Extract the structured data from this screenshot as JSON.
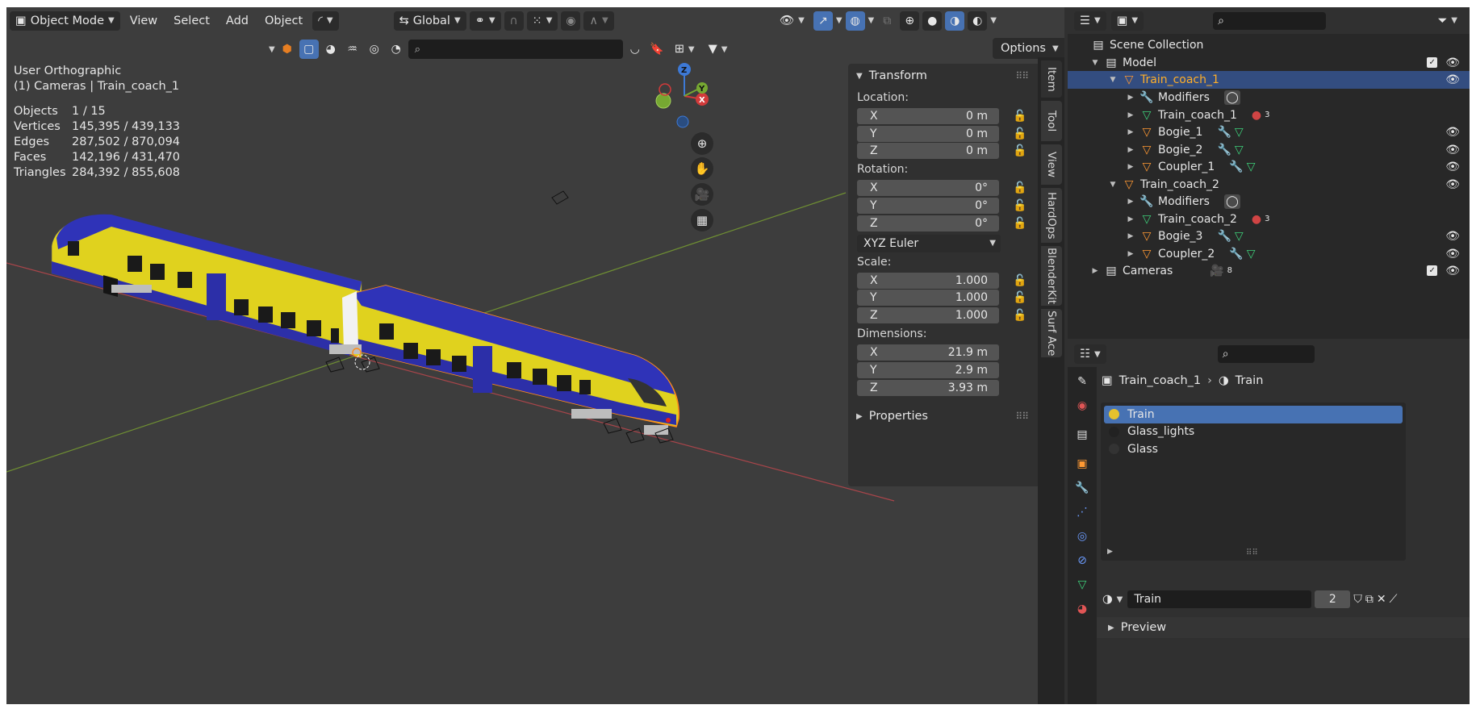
{
  "header": {
    "mode": "Object Mode",
    "menus": [
      "View",
      "Select",
      "Add",
      "Object"
    ],
    "orientation": "Global",
    "options": "Options"
  },
  "viewport": {
    "view_name": "User Orthographic",
    "context": "(1) Cameras | Train_coach_1",
    "stats": [
      {
        "label": "Objects",
        "value": "1 / 15"
      },
      {
        "label": "Vertices",
        "value": "145,395 / 439,133"
      },
      {
        "label": "Edges",
        "value": "287,502 / 870,094"
      },
      {
        "label": "Faces",
        "value": "142,196 / 431,470"
      },
      {
        "label": "Triangles",
        "value": "284,392 / 855,608"
      }
    ],
    "gizmo": {
      "x": "X",
      "y": "Y",
      "z": "Z"
    }
  },
  "transform": {
    "title": "Transform",
    "location_label": "Location:",
    "location": [
      {
        "axis": "X",
        "value": "0 m"
      },
      {
        "axis": "Y",
        "value": "0 m"
      },
      {
        "axis": "Z",
        "value": "0 m"
      }
    ],
    "rotation_label": "Rotation:",
    "rotation": [
      {
        "axis": "X",
        "value": "0°"
      },
      {
        "axis": "Y",
        "value": "0°"
      },
      {
        "axis": "Z",
        "value": "0°"
      }
    ],
    "rotation_mode": "XYZ Euler",
    "scale_label": "Scale:",
    "scale": [
      {
        "axis": "X",
        "value": "1.000"
      },
      {
        "axis": "Y",
        "value": "1.000"
      },
      {
        "axis": "Z",
        "value": "1.000"
      }
    ],
    "dimensions_label": "Dimensions:",
    "dimensions": [
      {
        "axis": "X",
        "value": "21.9 m"
      },
      {
        "axis": "Y",
        "value": "2.9 m"
      },
      {
        "axis": "Z",
        "value": "3.93 m"
      }
    ],
    "properties_title": "Properties"
  },
  "sidebar_tabs": [
    "Item",
    "Tool",
    "View",
    "HardOps",
    "BlenderKit",
    "Surf Ace"
  ],
  "outliner": {
    "rows": [
      {
        "label": "Scene Collection"
      },
      {
        "label": "Model"
      },
      {
        "label": "Train_coach_1"
      },
      {
        "label": "Modifiers"
      },
      {
        "label": "Train_coach_1",
        "badge": "3"
      },
      {
        "label": "Bogie_1"
      },
      {
        "label": "Bogie_2"
      },
      {
        "label": "Coupler_1"
      },
      {
        "label": "Train_coach_2"
      },
      {
        "label": "Modifiers"
      },
      {
        "label": "Train_coach_2",
        "badge": "3"
      },
      {
        "label": "Bogie_3"
      },
      {
        "label": "Coupler_2"
      },
      {
        "label": "Cameras",
        "badge": "8"
      }
    ]
  },
  "properties": {
    "breadcrumb_object": "Train_coach_1",
    "breadcrumb_material": "Train",
    "materials": [
      "Train",
      "Glass_lights",
      "Glass"
    ],
    "material_name": "Train",
    "user_count": "2",
    "preview_label": "Preview"
  },
  "colors": {
    "selection": "#4772b3",
    "outliner_selected_text": "#ffaf29",
    "train_blue": "#2a2fb3",
    "train_yellow": "#e6d51c"
  }
}
